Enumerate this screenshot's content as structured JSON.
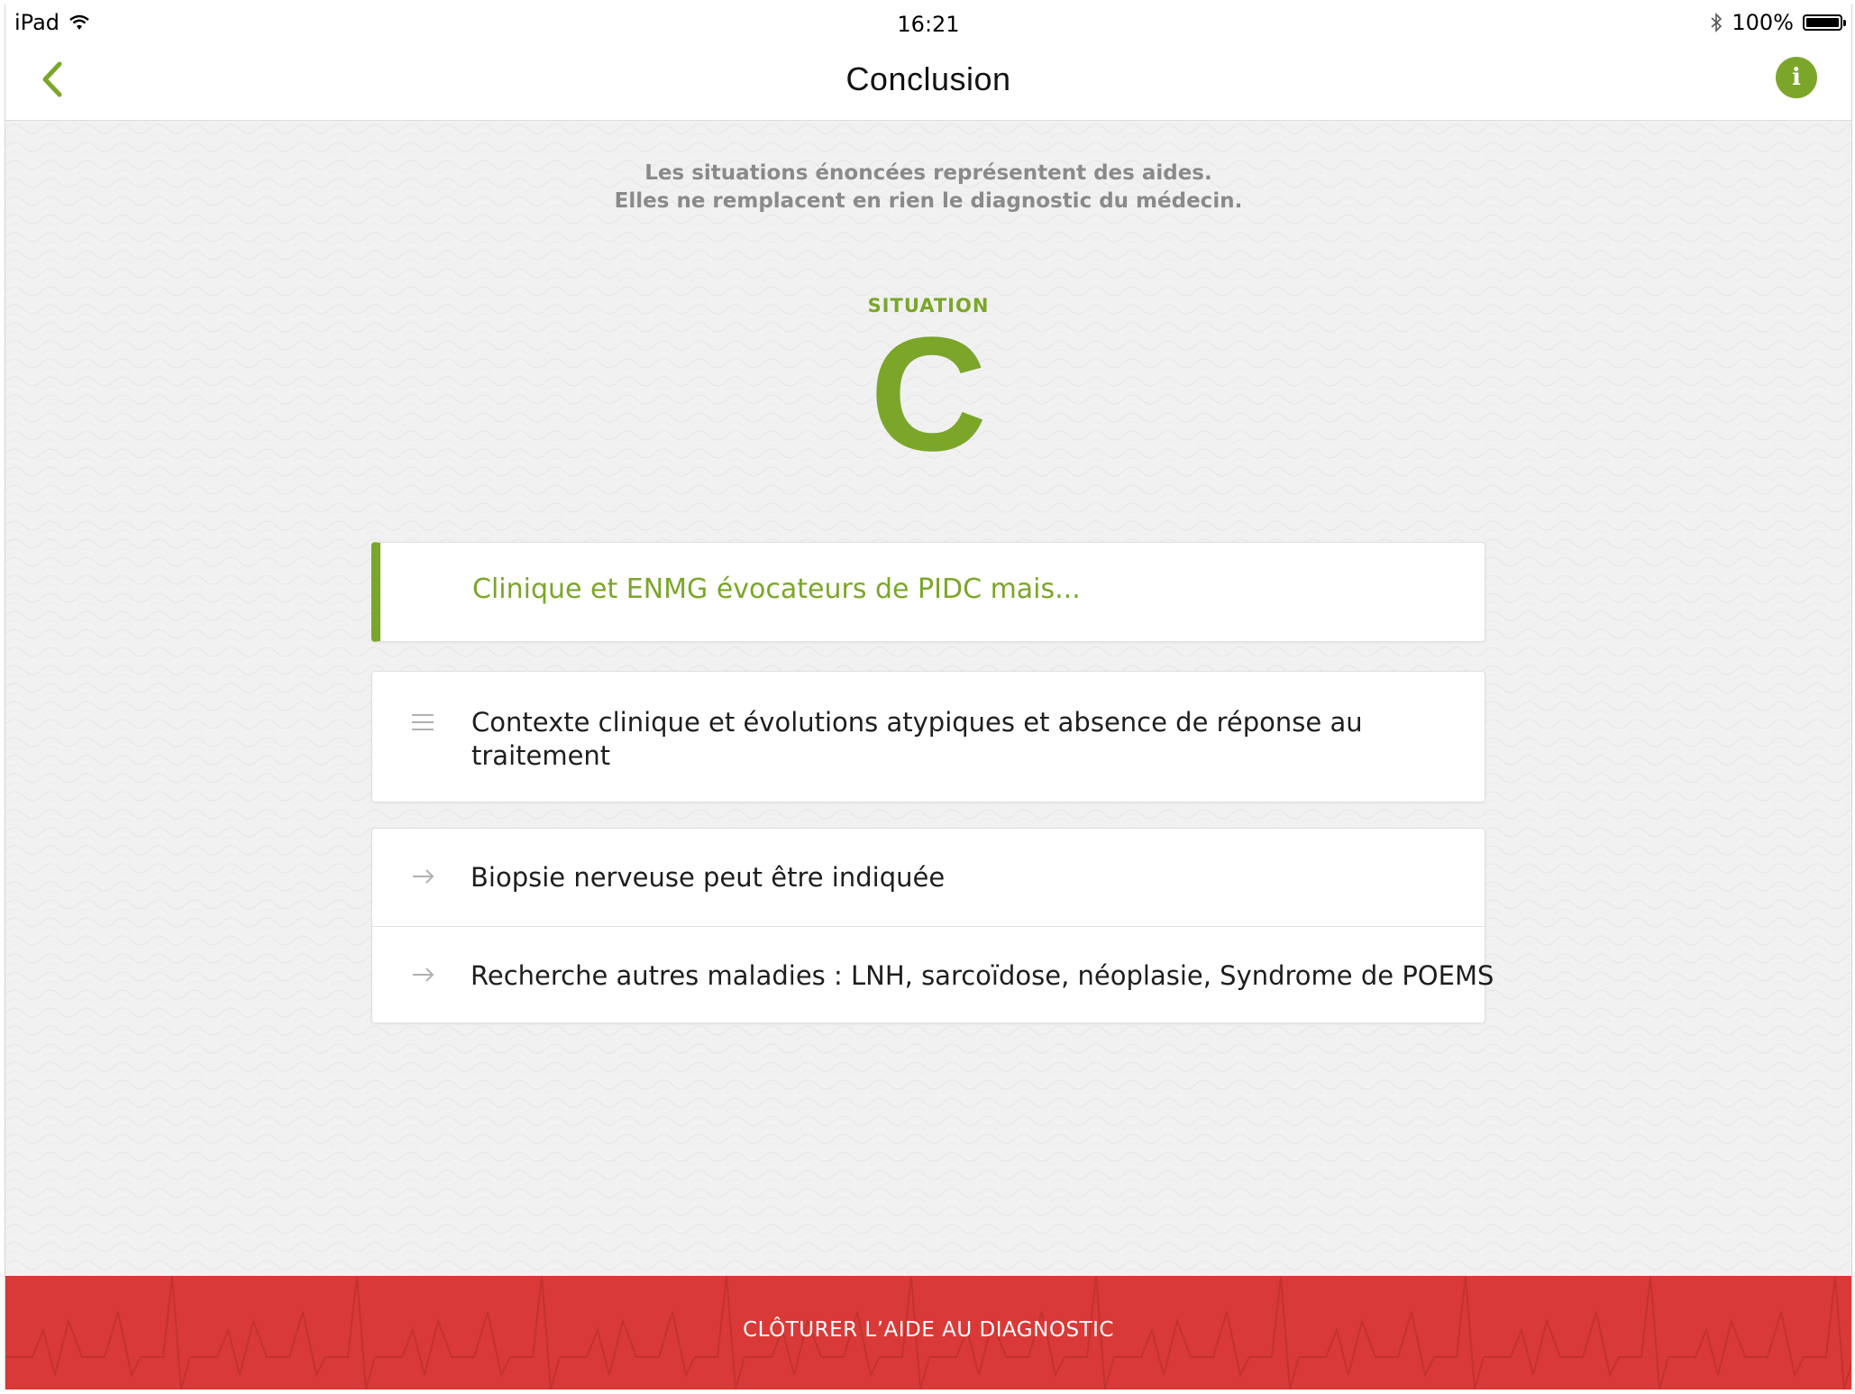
{
  "status_bar": {
    "device": "iPad",
    "time": "16:21",
    "battery": "100%"
  },
  "nav": {
    "title": "Conclusion",
    "info_label": "i"
  },
  "disclaimer": {
    "line1": "Les situations énoncées représentent des aides.",
    "line2": "Elles ne remplacent en rien le diagnostic du médecin."
  },
  "situation": {
    "label": "SITUATION",
    "letter": "C"
  },
  "cards": {
    "heading": "Clinique et ENMG évocateurs de PIDC mais...",
    "context": "Contexte clinique et évolutions atypiques et absence de réponse au traitement",
    "actions": [
      "Biopsie nerveuse peut être indiquée",
      "Recherche autres maladies : LNH, sarcoïdose, néoplasie, Syndrome de POEMS"
    ]
  },
  "footer": {
    "button_label": "CLÔTURER L’AIDE AU DIAGNOSTIC"
  },
  "colors": {
    "accent": "#7ba62a",
    "danger": "#d93a37",
    "background": "#f1f1f1"
  }
}
